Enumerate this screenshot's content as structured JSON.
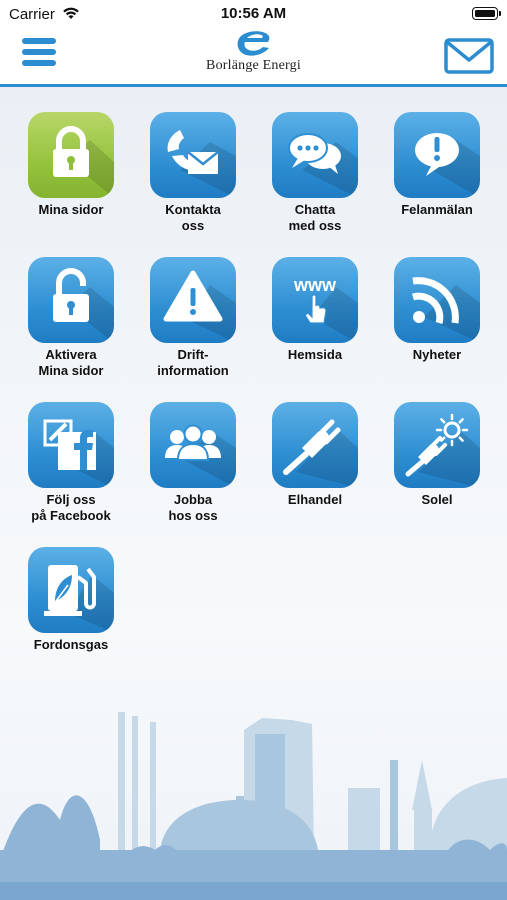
{
  "status_bar": {
    "carrier": "Carrier",
    "time": "10:56 AM",
    "icons": [
      "wifi-icon",
      "battery-icon"
    ]
  },
  "header": {
    "logo_text": "Borlänge Energi",
    "menu_icon": "hamburger-menu-icon",
    "mail_icon": "envelope-icon",
    "accent_color": "#2c8cd0"
  },
  "tiles": [
    {
      "label": "Mina sidor",
      "icon": "padlock-icon",
      "color": "green"
    },
    {
      "label": "Kontakta\noss",
      "icon": "phone-envelope-icon",
      "color": "blue"
    },
    {
      "label": "Chatta\nmed oss",
      "icon": "chat-bubbles-icon",
      "color": "blue"
    },
    {
      "label": "Felanmälan",
      "icon": "exclamation-bubble-icon",
      "color": "blue"
    },
    {
      "label": "Aktivera\nMina sidor",
      "icon": "open-padlock-icon",
      "color": "blue"
    },
    {
      "label": "Drift-\ninformation",
      "icon": "warning-triangle-icon",
      "color": "blue"
    },
    {
      "label": "Hemsida",
      "icon": "www-pointer-icon",
      "icon_text": "www",
      "color": "blue"
    },
    {
      "label": "Nyheter",
      "icon": "rss-icon",
      "color": "blue"
    },
    {
      "label": "Följ oss\npå Facebook",
      "icon": "facebook-icon",
      "color": "blue"
    },
    {
      "label": "Jobba\nhos oss",
      "icon": "people-group-icon",
      "color": "blue"
    },
    {
      "label": "Elhandel",
      "icon": "electric-plug-icon",
      "color": "blue"
    },
    {
      "label": "Solel",
      "icon": "plug-sun-icon",
      "color": "blue"
    },
    {
      "label": "Fordonsgas",
      "icon": "fuel-pump-leaf-icon",
      "color": "blue"
    }
  ]
}
